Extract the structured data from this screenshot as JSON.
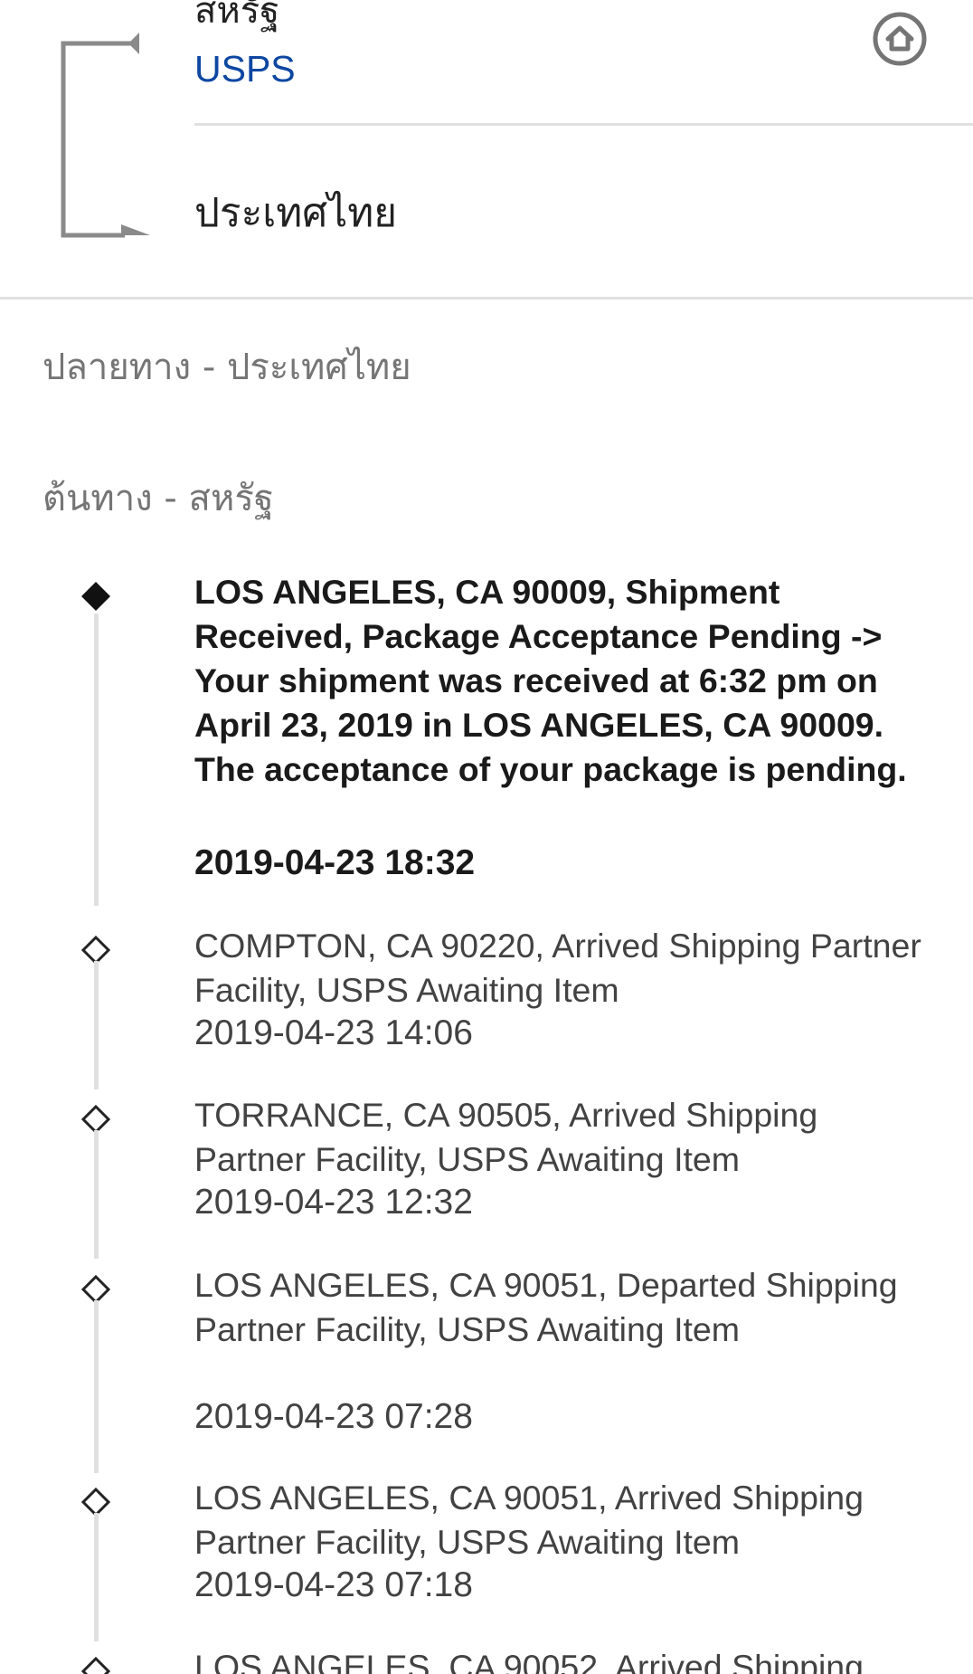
{
  "route": {
    "origin_country": "สหรัฐ",
    "carrier": "USPS",
    "destination_country": "ประเทศไทย",
    "home_icon": "home-circle-icon"
  },
  "sections": {
    "destination_label": "ปลายทาง - ประเทศไทย",
    "origin_label": "ต้นทาง - สหรัฐ"
  },
  "events": [
    {
      "description": "LOS ANGELES, CA 90009, Shipment Received, Package Acceptance Pending -> Your shipment was received at 6:32 pm on April 23, 2019 in LOS ANGELES, CA 90009. The acceptance of your package is pending.",
      "time": "2019-04-23 18:32",
      "current": true
    },
    {
      "description": "COMPTON, CA 90220, Arrived Shipping Partner Facility, USPS Awaiting Item",
      "time": "2019-04-23 14:06",
      "current": false
    },
    {
      "description": "TORRANCE, CA 90505, Arrived Shipping Partner Facility, USPS Awaiting Item",
      "time": "2019-04-23 12:32",
      "current": false
    },
    {
      "description": "LOS ANGELES, CA 90051, Departed Shipping Partner Facility, USPS Awaiting Item",
      "time": "2019-04-23 07:28",
      "current": false
    },
    {
      "description": "LOS ANGELES, CA 90051, Arrived Shipping Partner Facility, USPS Awaiting Item",
      "time": "2019-04-23 07:18",
      "current": false
    },
    {
      "description": "LOS ANGELES, CA 90052, Arrived Shipping",
      "time": "",
      "current": false
    }
  ],
  "colors": {
    "carrier_link": "#0d47a1",
    "rail": "#e0e0e0",
    "secondary_text": "#757575"
  }
}
